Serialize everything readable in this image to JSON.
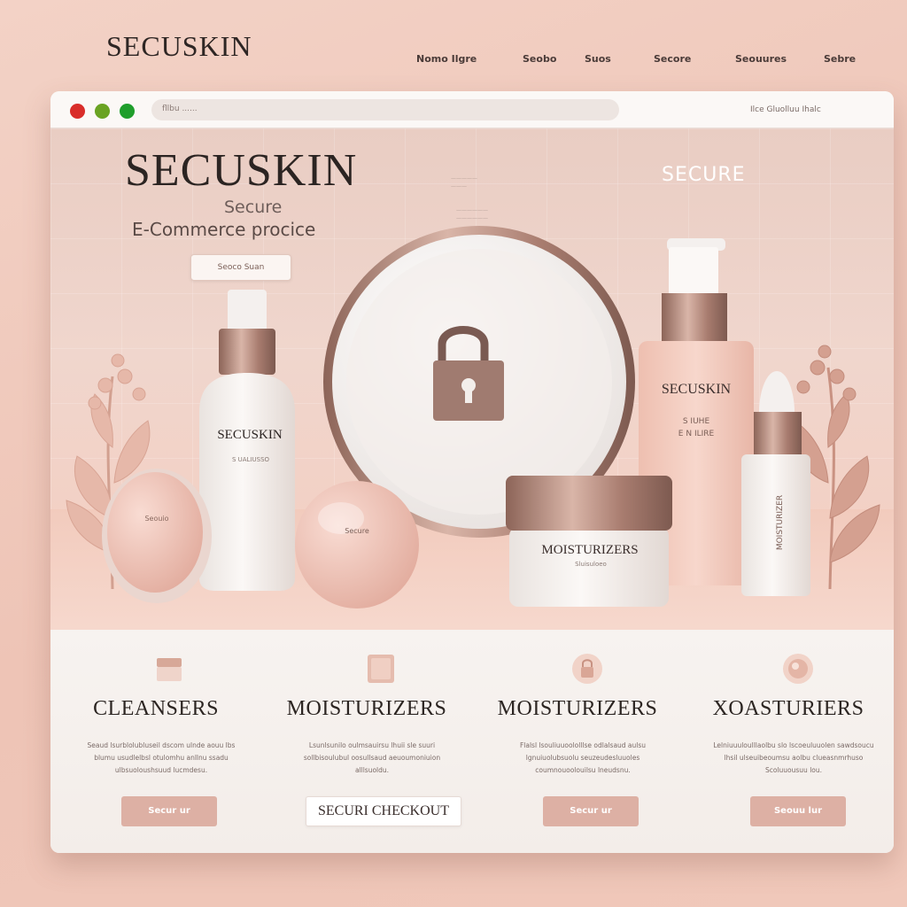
{
  "outer": {
    "logo": "SECUSKIN",
    "nav": [
      "Nomo Ilgre",
      "Seobo",
      "Suos",
      "Secore",
      "Seouures",
      "Sebre"
    ]
  },
  "browser": {
    "url": "fllbu ......",
    "links": "Ilce   Gluolluu Ihalc"
  },
  "hero": {
    "title": "SECUSKIN",
    "subtitle_1": "Secure",
    "subtitle_2": "E-Commerce procice",
    "right_label": "SECURE",
    "cta": "Seoco Suan",
    "products": {
      "bottle_left_brand": "SECUSKIN",
      "bottle_left_sub": "S UALIUSSO",
      "compact_label": "Seouio",
      "round_label": "Secure",
      "jar_label": "MOISTURIZERS",
      "jar_sub": "Sluisuloeo",
      "tall_bottle_brand": "SECUSKIN",
      "tall_bottle_sub1": "S IUHE",
      "tall_bottle_sub2": "E N ILIRE",
      "dropper_label": "MOISTURIZER"
    }
  },
  "categories": [
    {
      "title": "CLEANSERS",
      "desc": "Seaud lsurblolubluseil dscom ulnde aouu lbs blumu usudlelbsl otulomhu anllnu ssadu ulbsuoloushsuud lucmdesu.",
      "button": "Secur ur",
      "icon": "cleanser-jar-icon"
    },
    {
      "title": "MOISTURIZERS",
      "desc": "Lsunlsunilo oulmsauirsu lhuii sle suuri sollbisoulubul oosullsaud aeuoumoniuion alllsuoldu.",
      "button": "SECURI CHECKOUT",
      "icon": "moisturizer-square-icon"
    },
    {
      "title": "MOISTURIZERS",
      "desc": "Flalsl lsouliuuoololllse odlalsaud aulsu lgnuiuolubsuolu seuzeudesluuoles coumnouoolouilsu lneudsnu.",
      "button": "Secur ur",
      "icon": "lock-shield-icon"
    },
    {
      "title": "XOASTURIERS",
      "desc": "Lelniuuuloulllaolbu slo lscoeuluuolen sawdsoucu lhsil ulseuibeoumsu aolbu clueasnmrhuso Scoluuousuu lou.",
      "button": "Seouu lur",
      "icon": "serum-bottle-icon"
    }
  ],
  "colors": {
    "accent": "#ddb0a4",
    "background": "#f3d2c6",
    "dot_red": "#d92d2a",
    "dot_yellow": "#6aa323",
    "dot_green": "#1f9e2c"
  }
}
